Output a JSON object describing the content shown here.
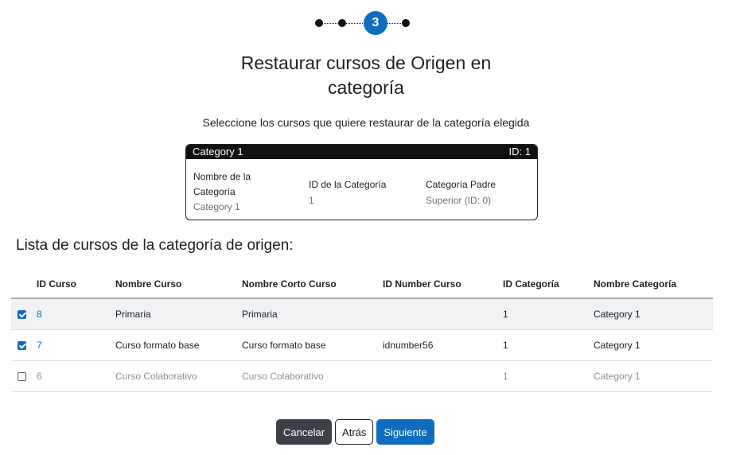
{
  "stepper": {
    "current_step": "3",
    "total_steps": 4
  },
  "page": {
    "title_line1": "Restaurar cursos de Origen en",
    "title_line2": "categoría",
    "subtitle": "Seleccione los cursos que quiere restaurar de la categoría elegida"
  },
  "category_card": {
    "name": "Category 1",
    "id_label": "ID: 1",
    "fields": [
      {
        "label_line1": "Nombre de la",
        "label_line2": "Categoría",
        "value": "Category 1"
      },
      {
        "label": "ID de la Categoría",
        "value": "1"
      },
      {
        "label": "Categoría Padre",
        "value": "Superior (ID: 0)"
      }
    ]
  },
  "list": {
    "title": "Lista de cursos de la categoría de origen:",
    "columns": [
      "ID Curso",
      "Nombre Curso",
      "Nombre Corto Curso",
      "ID Number Curso",
      "ID Categoría",
      "Nombre Categoría"
    ],
    "rows": [
      {
        "checked": true,
        "id": "8",
        "name": "Primaria",
        "shortname": "Primaria",
        "idnumber": "",
        "category_id": "1",
        "category_name": "Category 1"
      },
      {
        "checked": true,
        "id": "7",
        "name": "Curso formato base",
        "shortname": "Curso formato base",
        "idnumber": "idnumber56",
        "category_id": "1",
        "category_name": "Category 1"
      },
      {
        "checked": false,
        "id": "6",
        "name": "Curso Colaborativo",
        "shortname": "Curso Colaborativo",
        "idnumber": "",
        "category_id": "1",
        "category_name": "Category 1"
      }
    ]
  },
  "buttons": {
    "cancel": "Cancelar",
    "back": "Atrás",
    "next": "Siguiente"
  },
  "colors": {
    "primary": "#0f6cbf",
    "dark": "#3b4148"
  }
}
